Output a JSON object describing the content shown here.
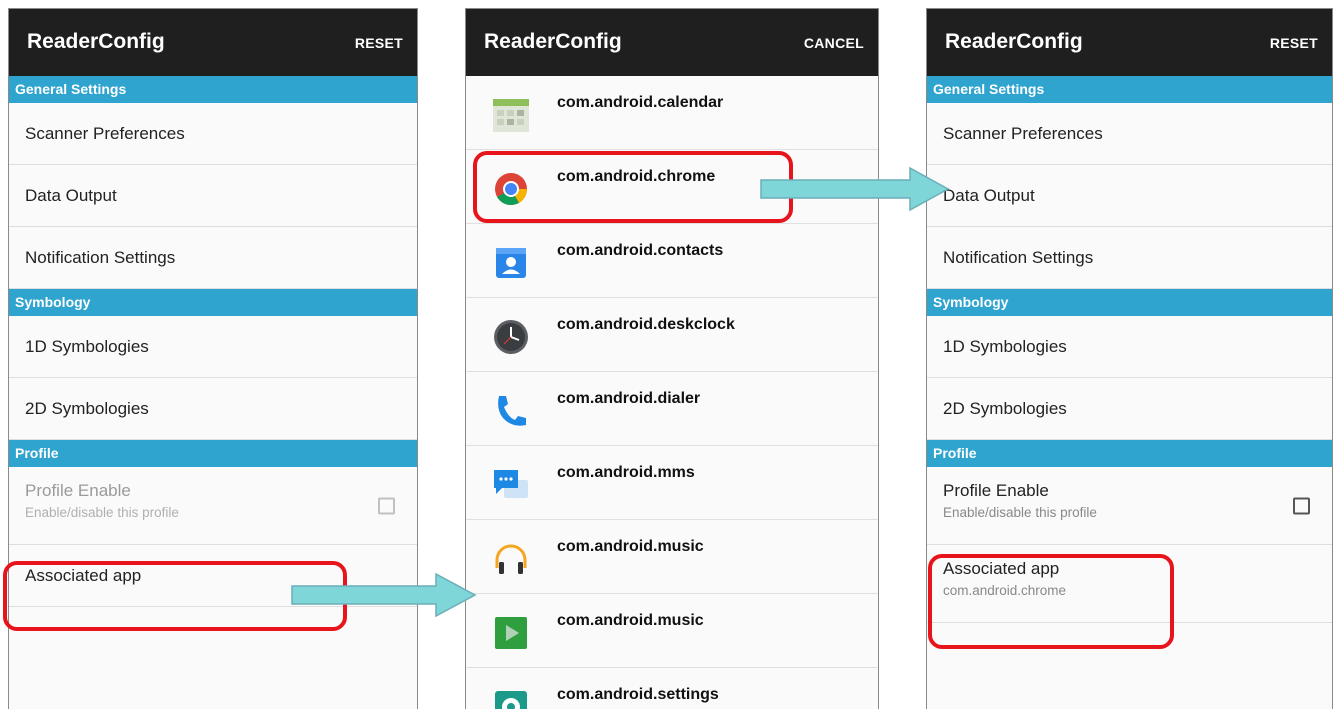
{
  "left_panel": {
    "title": "ReaderConfig",
    "action": "RESET",
    "sections": {
      "general": "General Settings",
      "symbology": "Symbology",
      "profile": "Profile"
    },
    "items": {
      "scanner_prefs": "Scanner Preferences",
      "data_output": "Data Output",
      "notification": "Notification Settings",
      "sym_1d": "1D Symbologies",
      "sym_2d": "2D Symbologies",
      "profile_enable": "Profile Enable",
      "profile_enable_sub": "Enable/disable this profile",
      "associated_app": "Associated app"
    }
  },
  "middle_panel": {
    "title": "ReaderConfig",
    "action": "CANCEL",
    "apps": [
      {
        "pkg": "com.android.calendar",
        "icon": "calendar-icon"
      },
      {
        "pkg": "com.android.chrome",
        "icon": "chrome-icon"
      },
      {
        "pkg": "com.android.contacts",
        "icon": "contacts-icon"
      },
      {
        "pkg": "com.android.deskclock",
        "icon": "clock-icon"
      },
      {
        "pkg": "com.android.dialer",
        "icon": "phone-icon"
      },
      {
        "pkg": "com.android.mms",
        "icon": "messaging-icon"
      },
      {
        "pkg": "com.android.music",
        "icon": "headphones-icon"
      },
      {
        "pkg": "com.android.music",
        "icon": "play-icon"
      },
      {
        "pkg": "com.android.settings",
        "icon": "settings-icon"
      }
    ]
  },
  "right_panel": {
    "title": "ReaderConfig",
    "action": "RESET",
    "sections": {
      "general": "General Settings",
      "symbology": "Symbology",
      "profile": "Profile"
    },
    "items": {
      "scanner_prefs": "Scanner Preferences",
      "data_output": "Data Output",
      "notification": "Notification Settings",
      "sym_1d": "1D Symbologies",
      "sym_2d": "2D Symbologies",
      "profile_enable": "Profile Enable",
      "profile_enable_sub": "Enable/disable this profile",
      "associated_app": "Associated app",
      "associated_app_value": "com.android.chrome"
    }
  },
  "colors": {
    "appbar": "#1f1f1f",
    "section": "#2fa4cf",
    "highlight": "#e8141c",
    "arrow": "#7fd6d8"
  }
}
